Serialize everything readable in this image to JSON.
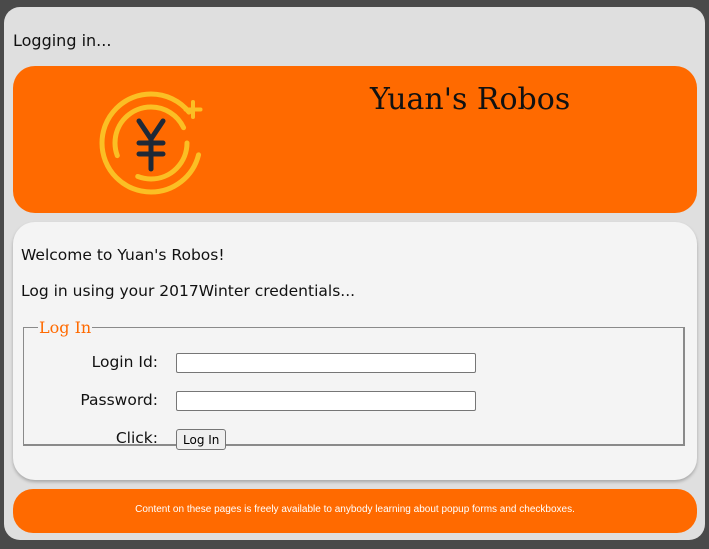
{
  "status_text": "Logging in...",
  "header": {
    "site_title": "Yuan's Robos",
    "logo_icon": "yuan-coin-icon",
    "background_color": "#ff6a00"
  },
  "content": {
    "welcome": "Welcome to Yuan's Robos!",
    "instructions": "Log in using your 2017Winter credentials..."
  },
  "login_form": {
    "legend": "Log In",
    "login_id_label": "Login Id:",
    "login_id_value": "",
    "password_label": "Password:",
    "password_value": "",
    "click_label": "Click:",
    "submit_label": "Log In"
  },
  "footer": {
    "text": "Content on these pages is freely available to anybody learning about popup forms and checkboxes."
  },
  "colors": {
    "accent": "#ff6a00",
    "logo_ring": "#fbbf24",
    "logo_symbol": "#1f2937"
  }
}
